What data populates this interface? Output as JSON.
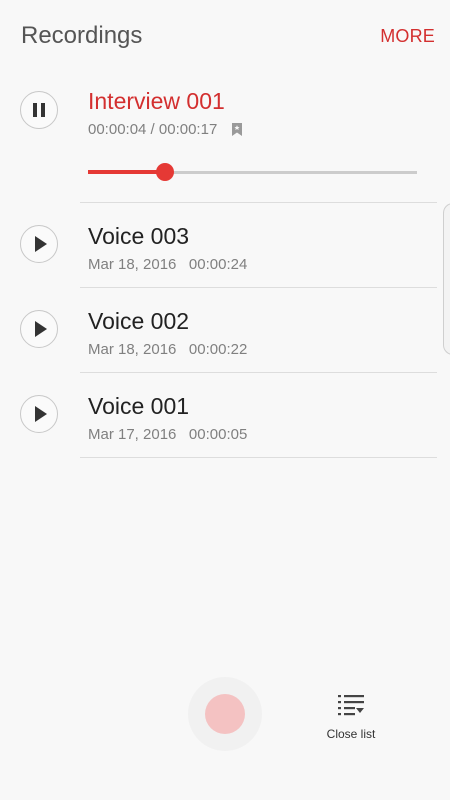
{
  "header": {
    "title": "Recordings",
    "more_label": "MORE"
  },
  "active_recording": {
    "name": "Interview 001",
    "time": "00:00:04 / 00:00:17",
    "progress_fraction": 0.235
  },
  "recordings": [
    {
      "name": "Voice 003",
      "date": "Mar 18, 2016",
      "duration": "00:00:24"
    },
    {
      "name": "Voice 002",
      "date": "Mar 18, 2016",
      "duration": "00:00:22"
    },
    {
      "name": "Voice 001",
      "date": "Mar 17, 2016",
      "duration": "00:00:05"
    }
  ],
  "bottom": {
    "close_list_label": "Close list"
  },
  "colors": {
    "accent": "#d32f2f",
    "record_button": "#f4c2c2"
  },
  "icons": {
    "active": "pause-icon",
    "items": "play-icon",
    "bookmark": "bookmark-icon",
    "close_list": "list-icon"
  }
}
